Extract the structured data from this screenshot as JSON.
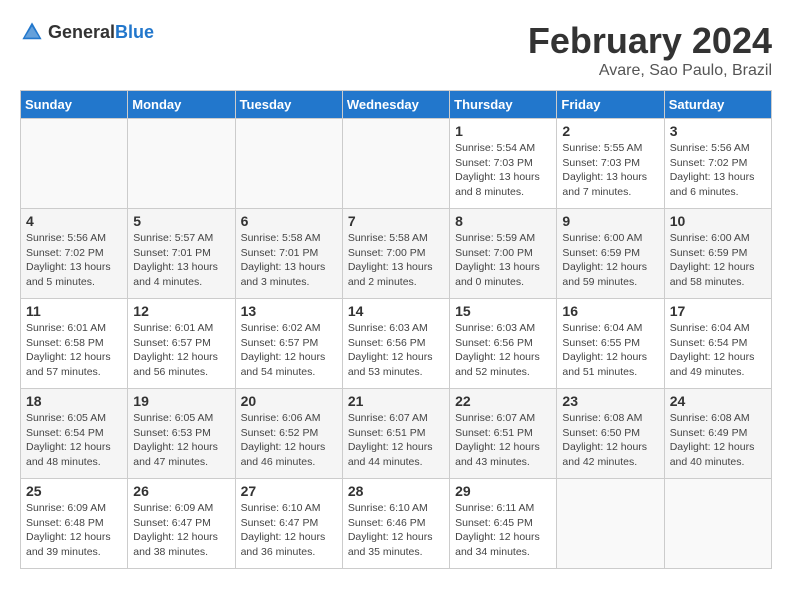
{
  "header": {
    "logo_general": "General",
    "logo_blue": "Blue",
    "month": "February 2024",
    "location": "Avare, Sao Paulo, Brazil"
  },
  "weekdays": [
    "Sunday",
    "Monday",
    "Tuesday",
    "Wednesday",
    "Thursday",
    "Friday",
    "Saturday"
  ],
  "weeks": [
    [
      {
        "day": "",
        "info": ""
      },
      {
        "day": "",
        "info": ""
      },
      {
        "day": "",
        "info": ""
      },
      {
        "day": "",
        "info": ""
      },
      {
        "day": "1",
        "info": "Sunrise: 5:54 AM\nSunset: 7:03 PM\nDaylight: 13 hours\nand 8 minutes."
      },
      {
        "day": "2",
        "info": "Sunrise: 5:55 AM\nSunset: 7:03 PM\nDaylight: 13 hours\nand 7 minutes."
      },
      {
        "day": "3",
        "info": "Sunrise: 5:56 AM\nSunset: 7:02 PM\nDaylight: 13 hours\nand 6 minutes."
      }
    ],
    [
      {
        "day": "4",
        "info": "Sunrise: 5:56 AM\nSunset: 7:02 PM\nDaylight: 13 hours\nand 5 minutes."
      },
      {
        "day": "5",
        "info": "Sunrise: 5:57 AM\nSunset: 7:01 PM\nDaylight: 13 hours\nand 4 minutes."
      },
      {
        "day": "6",
        "info": "Sunrise: 5:58 AM\nSunset: 7:01 PM\nDaylight: 13 hours\nand 3 minutes."
      },
      {
        "day": "7",
        "info": "Sunrise: 5:58 AM\nSunset: 7:00 PM\nDaylight: 13 hours\nand 2 minutes."
      },
      {
        "day": "8",
        "info": "Sunrise: 5:59 AM\nSunset: 7:00 PM\nDaylight: 13 hours\nand 0 minutes."
      },
      {
        "day": "9",
        "info": "Sunrise: 6:00 AM\nSunset: 6:59 PM\nDaylight: 12 hours\nand 59 minutes."
      },
      {
        "day": "10",
        "info": "Sunrise: 6:00 AM\nSunset: 6:59 PM\nDaylight: 12 hours\nand 58 minutes."
      }
    ],
    [
      {
        "day": "11",
        "info": "Sunrise: 6:01 AM\nSunset: 6:58 PM\nDaylight: 12 hours\nand 57 minutes."
      },
      {
        "day": "12",
        "info": "Sunrise: 6:01 AM\nSunset: 6:57 PM\nDaylight: 12 hours\nand 56 minutes."
      },
      {
        "day": "13",
        "info": "Sunrise: 6:02 AM\nSunset: 6:57 PM\nDaylight: 12 hours\nand 54 minutes."
      },
      {
        "day": "14",
        "info": "Sunrise: 6:03 AM\nSunset: 6:56 PM\nDaylight: 12 hours\nand 53 minutes."
      },
      {
        "day": "15",
        "info": "Sunrise: 6:03 AM\nSunset: 6:56 PM\nDaylight: 12 hours\nand 52 minutes."
      },
      {
        "day": "16",
        "info": "Sunrise: 6:04 AM\nSunset: 6:55 PM\nDaylight: 12 hours\nand 51 minutes."
      },
      {
        "day": "17",
        "info": "Sunrise: 6:04 AM\nSunset: 6:54 PM\nDaylight: 12 hours\nand 49 minutes."
      }
    ],
    [
      {
        "day": "18",
        "info": "Sunrise: 6:05 AM\nSunset: 6:54 PM\nDaylight: 12 hours\nand 48 minutes."
      },
      {
        "day": "19",
        "info": "Sunrise: 6:05 AM\nSunset: 6:53 PM\nDaylight: 12 hours\nand 47 minutes."
      },
      {
        "day": "20",
        "info": "Sunrise: 6:06 AM\nSunset: 6:52 PM\nDaylight: 12 hours\nand 46 minutes."
      },
      {
        "day": "21",
        "info": "Sunrise: 6:07 AM\nSunset: 6:51 PM\nDaylight: 12 hours\nand 44 minutes."
      },
      {
        "day": "22",
        "info": "Sunrise: 6:07 AM\nSunset: 6:51 PM\nDaylight: 12 hours\nand 43 minutes."
      },
      {
        "day": "23",
        "info": "Sunrise: 6:08 AM\nSunset: 6:50 PM\nDaylight: 12 hours\nand 42 minutes."
      },
      {
        "day": "24",
        "info": "Sunrise: 6:08 AM\nSunset: 6:49 PM\nDaylight: 12 hours\nand 40 minutes."
      }
    ],
    [
      {
        "day": "25",
        "info": "Sunrise: 6:09 AM\nSunset: 6:48 PM\nDaylight: 12 hours\nand 39 minutes."
      },
      {
        "day": "26",
        "info": "Sunrise: 6:09 AM\nSunset: 6:47 PM\nDaylight: 12 hours\nand 38 minutes."
      },
      {
        "day": "27",
        "info": "Sunrise: 6:10 AM\nSunset: 6:47 PM\nDaylight: 12 hours\nand 36 minutes."
      },
      {
        "day": "28",
        "info": "Sunrise: 6:10 AM\nSunset: 6:46 PM\nDaylight: 12 hours\nand 35 minutes."
      },
      {
        "day": "29",
        "info": "Sunrise: 6:11 AM\nSunset: 6:45 PM\nDaylight: 12 hours\nand 34 minutes."
      },
      {
        "day": "",
        "info": ""
      },
      {
        "day": "",
        "info": ""
      }
    ]
  ]
}
